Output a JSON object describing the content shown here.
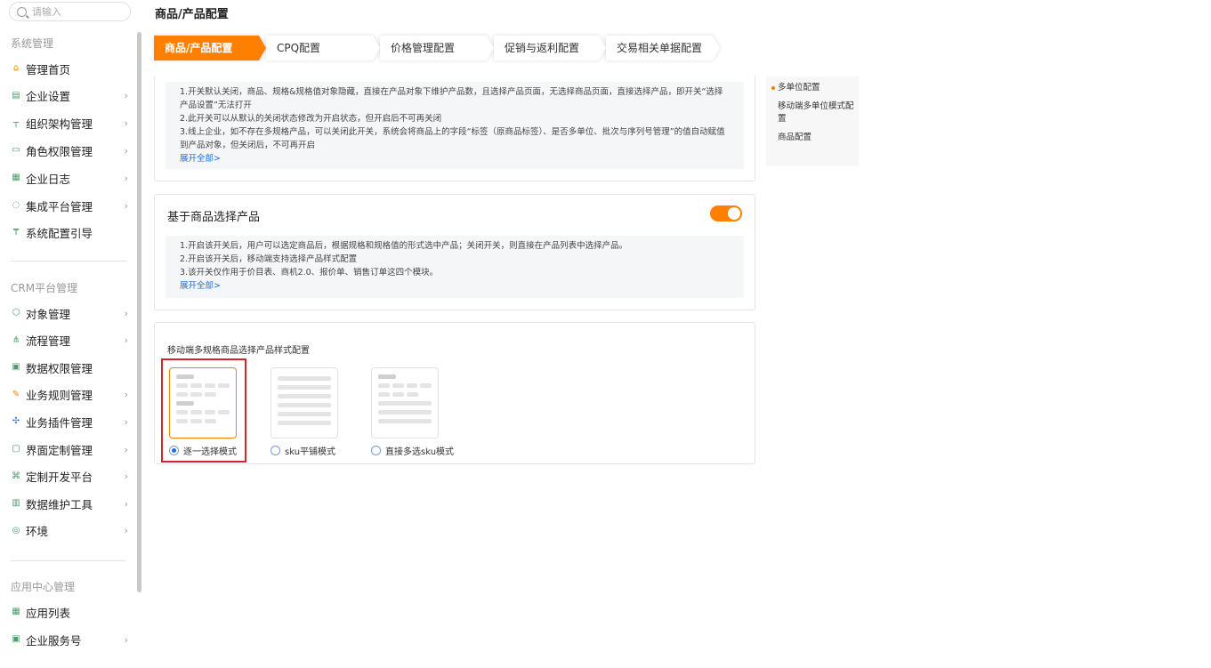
{
  "search": {
    "placeholder": "请输入"
  },
  "sidebar": {
    "group_system": "系统管理",
    "system_items": [
      {
        "label": "管理首页",
        "icon": "home-icon",
        "arrow": false
      },
      {
        "label": "企业设置",
        "icon": "building-icon",
        "arrow": true
      },
      {
        "label": "组织架构管理",
        "icon": "org-tree-icon",
        "arrow": true
      },
      {
        "label": "角色权限管理",
        "icon": "id-card-icon",
        "arrow": true
      },
      {
        "label": "企业日志",
        "icon": "log-icon",
        "arrow": true
      },
      {
        "label": "集成平台管理",
        "icon": "integration-icon",
        "arrow": true
      },
      {
        "label": "系统配置引导",
        "icon": "guide-icon",
        "arrow": false
      }
    ],
    "group_crm": "CRM平台管理",
    "crm_items": [
      {
        "label": "对象管理",
        "icon": "cube-icon",
        "arrow": true
      },
      {
        "label": "流程管理",
        "icon": "flow-icon",
        "arrow": true
      },
      {
        "label": "数据权限管理",
        "icon": "data-permission-icon",
        "arrow": false
      },
      {
        "label": "业务规则管理",
        "icon": "rule-icon",
        "arrow": true
      },
      {
        "label": "业务插件管理",
        "icon": "plugin-icon",
        "arrow": true
      },
      {
        "label": "界面定制管理",
        "icon": "layout-icon",
        "arrow": true
      },
      {
        "label": "定制开发平台",
        "icon": "code-icon",
        "arrow": true
      },
      {
        "label": "数据维护工具",
        "icon": "chart-icon",
        "arrow": true
      },
      {
        "label": "环境",
        "icon": "environment-icon",
        "arrow": true
      }
    ],
    "group_app": "应用中心管理",
    "app_items": [
      {
        "label": "应用列表",
        "icon": "grid-icon",
        "arrow": false
      },
      {
        "label": "企业服务号",
        "icon": "service-icon",
        "arrow": true
      }
    ]
  },
  "header": {
    "title": "商品/产品配置"
  },
  "tabs": [
    {
      "label": "商品/产品配置",
      "active": true
    },
    {
      "label": "CPQ配置",
      "active": false
    },
    {
      "label": "价格管理配置",
      "active": false
    },
    {
      "label": "促销与返利配置",
      "active": false
    },
    {
      "label": "交易相关单据配置",
      "active": false
    }
  ],
  "card1": {
    "lines": [
      "1.开关默认关闭，商品、规格&规格值对象隐藏，直接在产品对象下维护产品数，且选择产品页面，无选择商品页面，直接选择产品，即开关“选择产品设置”无法打开",
      "2.此开关可以从默认的关闭状态修改为开启状态，但开启后不可再关闭",
      "3.线上企业，如不存在多规格产品，可以关闭此开关，系统会将商品上的字段“标签（原商品标签）、是否多单位、批次与序列号管理”的值自动赋值到产品对象，但关闭后，不可再开启"
    ],
    "expand": "展开全部>"
  },
  "card2": {
    "title": "基于商品选择产品",
    "toggle_on": true,
    "lines": [
      "1.开启该开关后，用户可以选定商品后，根据规格和规格值的形式选中产品；关闭开关，则直接在产品列表中选择产品。",
      "2.开启该开关后，移动端支持选择产品样式配置",
      "3.该开关仅作用于价目表、商机2.0、报价单、销售订单这四个模块。"
    ],
    "expand": "展开全部>"
  },
  "card3": {
    "title": "移动端多规格商品选择产品样式配置",
    "options": [
      {
        "label": "逐一选择模式",
        "checked": true
      },
      {
        "label": "sku平铺模式",
        "checked": false
      },
      {
        "label": "直接多选sku模式",
        "checked": false
      }
    ]
  },
  "anchors": [
    {
      "label": "多单位配置",
      "active": true
    },
    {
      "label": "移动端多单位模式配置",
      "active": false
    },
    {
      "label": "商品配置",
      "active": false
    }
  ],
  "colors": {
    "accent": "#ff8000",
    "link": "#1e6fd9",
    "highlight": "#d9232a"
  }
}
